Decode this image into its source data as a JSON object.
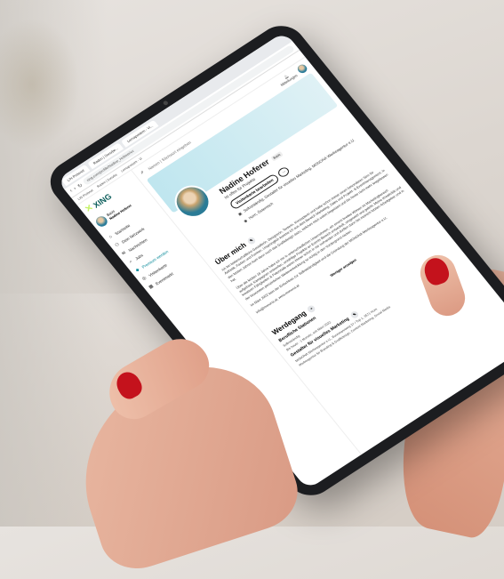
{
  "colors": {
    "accent": "#0a8a9a",
    "xing_green": "#c6f26a",
    "xing_teal": "#0a5c5a",
    "nail": "#c4121c"
  },
  "decoration": {
    "script_text": "x"
  },
  "browser": {
    "tabs": [
      "LIN Preisnet",
      "Raden | Sorsrbe...",
      "Lernapostem - Vi..."
    ],
    "address": "xing.com/profile/Nadine_Hoferer/cv",
    "bookmarks": [
      "LIN Preisnet",
      "Raden | Sorsrbe",
      "Lernapostem - Vi"
    ]
  },
  "sidebar": {
    "logo_text": "XING",
    "me_label": "Basis",
    "me_name": "Nadine Hoferer",
    "items": [
      {
        "icon": "home-icon",
        "label": "Startseite"
      },
      {
        "icon": "network-icon",
        "label": "Dein Netzwerk"
      },
      {
        "icon": "messages-icon",
        "label": "Nachrichten"
      },
      {
        "icon": "jobs-icon",
        "label": "Jobs"
      },
      {
        "icon": "premium-icon",
        "label": "Premium werden"
      },
      {
        "icon": "camera-icon",
        "label": "Visitenkarte"
      },
      {
        "icon": "calendar-icon",
        "label": "Eventmarkt"
      }
    ]
  },
  "topbar": {
    "search_placeholder": "Namen | Stichwort eingeben",
    "notifications_label": "Mitteilungen"
  },
  "profile": {
    "name": "Nadine Hoferer",
    "badge": "Basis",
    "headline": "Ist offen für Projekte",
    "edit_button": "Visitenkarte bearbeiten",
    "more_button": "...",
    "role": "Selbstständig, Gestalter für visuelles Marketing, MONONA Werbeagentur e.U.",
    "location": "Horn, Österreich"
  },
  "about": {
    "title": "Über mich",
    "p1": "Ich bin leidenschaftliche Gestalterin, Designerin, Texterin, Konzepterin und hatte schon immer einen besonderen Sinn für Ästhetik, Farben und Formen. Ursprünglich komme ich aus dem Bereich Marketing, Sales und Projekt- & Eventmanagement. In den letzten Jahren kam dann noch das Grafikdesign dazu, welches mich sofort begeistert und bis heute nicht mehr losgelassen hat.",
    "p2": "Über die letzten 18 Jahre habe ich mir in unterschiedlichen Unternehmen, ein enorm breites Wissen im Marketingbereich aufgebaut, Kampagnen entworfen, unzählige Projekte an Events Bereich entwickelt, umgesetzt und gelebt. Meine Kreativität und kreativen Fähigkeiten & Potenziale waren immer schon in mir vorhanden und durften dann bei meinem letzten Arbeitgeber und in der bewussten persönlichen Weiterentwicklung so richtig in den Vordergrund rücken.",
    "p3": "Im März 2022 kam der Entschluss zur Selbstständigkeit und die Gründung der MONONA Werbeagentur e.U.",
    "contact": "info@monona.at, www.monona.at",
    "more_link": "Weniger anzeigen"
  },
  "experience": {
    "title": "Werdegang",
    "subtitle": "Berufliche Stationen",
    "status": "Selbstständig",
    "period": "Bis heute · 1 Monate, seit März 2022",
    "job_title": "Gestalter für visuelles Marketing",
    "company": "MONONA Werbeagentur e.U., Bonnmannweg 37 / Top 1, 3571 Horn",
    "desc": "Werbeagentur für Branding & Grafikdesign, Content Marketing, Social Media"
  }
}
